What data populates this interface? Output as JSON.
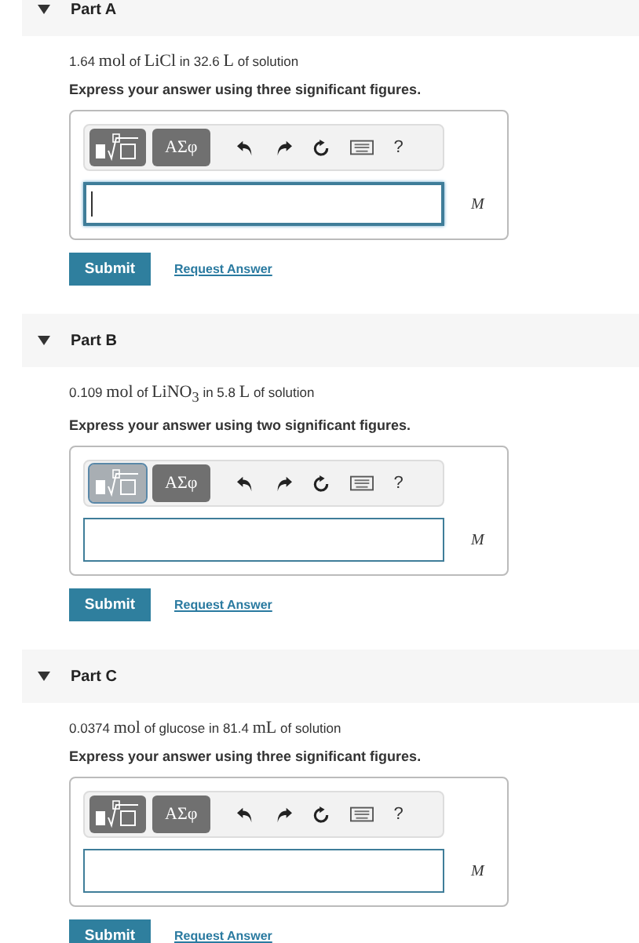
{
  "parts": [
    {
      "title": "Part A",
      "expanded": true,
      "prompt": [
        {
          "kind": "text",
          "text": "1.64 "
        },
        {
          "kind": "math",
          "text": "mol"
        },
        {
          "kind": "text",
          "text": " of "
        },
        {
          "kind": "math",
          "text": "LiCl"
        },
        {
          "kind": "text",
          "text": " in 32.6 "
        },
        {
          "kind": "math",
          "text": "L"
        },
        {
          "kind": "text",
          "text": " of solution"
        }
      ],
      "instruction": "Express your answer using three significant figures.",
      "toolbar": {
        "symbols_label": "ΑΣφ",
        "help_label": "?",
        "template_selected": false
      },
      "answer": {
        "focused": true,
        "unit": "M"
      },
      "submit": "Submit",
      "request": "Request Answer"
    },
    {
      "title": "Part B",
      "expanded": true,
      "prompt": [
        {
          "kind": "text",
          "text": "0.109 "
        },
        {
          "kind": "math",
          "text": "mol"
        },
        {
          "kind": "text",
          "text": " of "
        },
        {
          "kind": "math",
          "text": "LiNO$_{3}$"
        },
        {
          "kind": "text",
          "text": "  in 5.8 "
        },
        {
          "kind": "math",
          "text": "L"
        },
        {
          "kind": "text",
          "text": " of solution"
        }
      ],
      "instruction": "Express your answer using two significant figures.",
      "toolbar": {
        "symbols_label": "ΑΣφ",
        "help_label": "?",
        "template_selected": true
      },
      "answer": {
        "focused": false,
        "unit": "M"
      },
      "submit": "Submit",
      "request": "Request Answer"
    },
    {
      "title": "Part C",
      "expanded": true,
      "prompt": [
        {
          "kind": "text",
          "text": "0.0374 "
        },
        {
          "kind": "math",
          "text": "mol"
        },
        {
          "kind": "text",
          "text": " of glucose in 81.4 "
        },
        {
          "kind": "math",
          "text": "mL"
        },
        {
          "kind": "text",
          "text": " of solution"
        }
      ],
      "instruction": "Express your answer using three significant figures.",
      "toolbar": {
        "symbols_label": "ΑΣφ",
        "help_label": "?",
        "template_selected": false
      },
      "answer": {
        "focused": false,
        "unit": "M"
      },
      "submit": "Submit",
      "request": "Request Answer"
    }
  ]
}
